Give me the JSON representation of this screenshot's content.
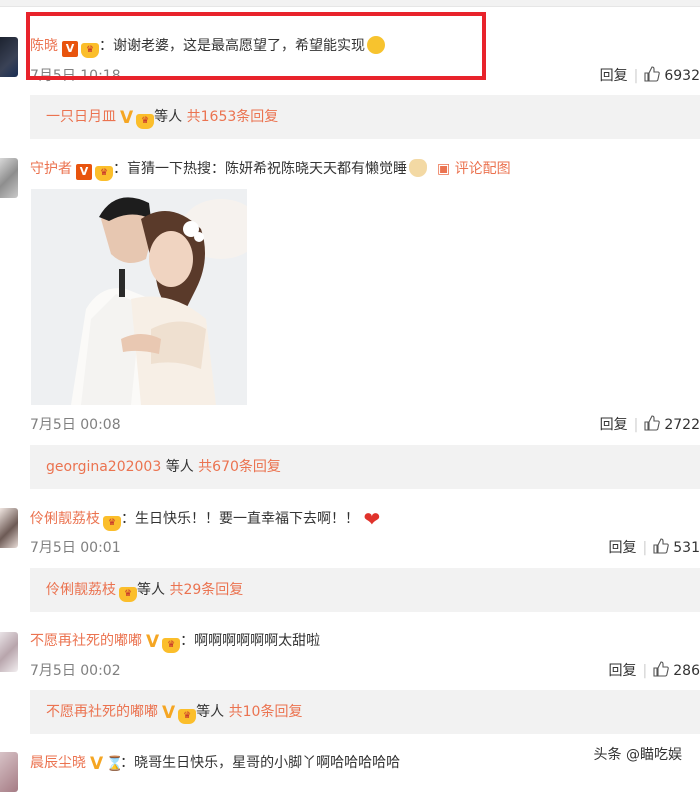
{
  "comments": [
    {
      "user": "陈晓",
      "text": "谢谢老婆，这是最高愿望了，希望能实现",
      "time": "7月5日 10:18",
      "reply_label": "回复",
      "likes": "6932",
      "thread": {
        "user": "一只日月皿",
        "mid": "等人",
        "count": "共1653条回复"
      }
    },
    {
      "user": "守护者",
      "text": "盲猜一下热搜：陈妍希祝陈晓天天都有懒觉睡",
      "pic_link": "评论配图",
      "time": "7月5日 00:08",
      "reply_label": "回复",
      "likes": "2722",
      "thread": {
        "user": "georgina202003",
        "mid": "等人",
        "count": "共670条回复"
      }
    },
    {
      "user": "伶俐靓荔枝",
      "text": "生日快乐！！要一直幸福下去啊！！",
      "time": "7月5日 00:01",
      "reply_label": "回复",
      "likes": "531",
      "thread": {
        "user": "伶俐靓荔枝",
        "mid": "等人",
        "count": "共29条回复"
      }
    },
    {
      "user": "不愿再社死的嘟嘟",
      "text": "啊啊啊啊啊啊太甜啦",
      "time": "7月5日 00:02",
      "reply_label": "回复",
      "likes": "286",
      "thread": {
        "user": "不愿再社死的嘟嘟",
        "mid": "等人",
        "count": "共10条回复"
      }
    },
    {
      "user": "晨辰尘晓",
      "text": "晓哥生日快乐，星哥的小脚丫啊哈哈哈哈哈"
    }
  ],
  "badges": {
    "v": "V"
  },
  "watermark": "头条 @瞄吃娱",
  "colors": {
    "username": "#eb7350",
    "highlight_box": "#e8232b",
    "thread_bg": "#f2f2f2"
  }
}
